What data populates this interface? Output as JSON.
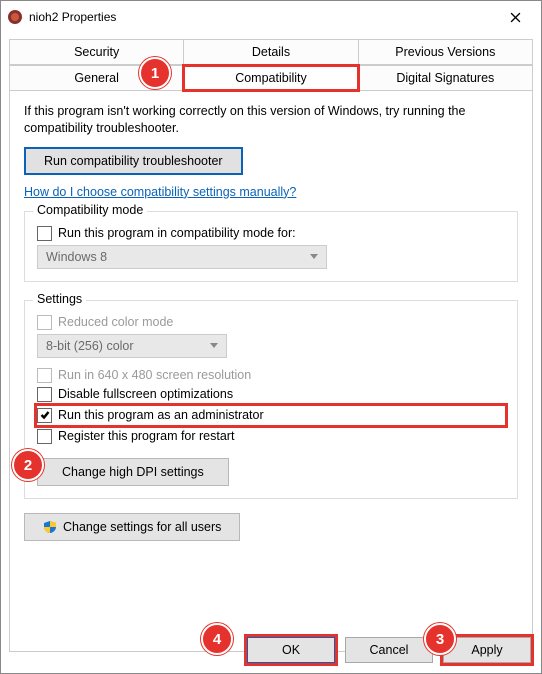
{
  "window": {
    "title": "nioh2 Properties"
  },
  "tabs": {
    "row1": [
      "Security",
      "Details",
      "Previous Versions"
    ],
    "row2": [
      "General",
      "Compatibility",
      "Digital Signatures"
    ],
    "active": "Compatibility"
  },
  "intro": "If this program isn't working correctly on this version of Windows, try running the compatibility troubleshooter.",
  "buttons": {
    "troubleshooter": "Run compatibility troubleshooter",
    "dpi": "Change high DPI settings",
    "allusers": "Change settings for all users",
    "ok": "OK",
    "cancel": "Cancel",
    "apply": "Apply"
  },
  "link": "How do I choose compatibility settings manually?",
  "compat": {
    "legend": "Compatibility mode",
    "checkbox": "Run this program in compatibility mode for:",
    "select": "Windows 8"
  },
  "settings": {
    "legend": "Settings",
    "reduced": "Reduced color mode",
    "colorSelect": "8-bit (256) color",
    "run640": "Run in 640 x 480 screen resolution",
    "disableFs": "Disable fullscreen optimizations",
    "runAdmin": "Run this program as an administrator",
    "register": "Register this program for restart"
  },
  "badges": {
    "b1": "1",
    "b2": "2",
    "b3": "3",
    "b4": "4"
  }
}
